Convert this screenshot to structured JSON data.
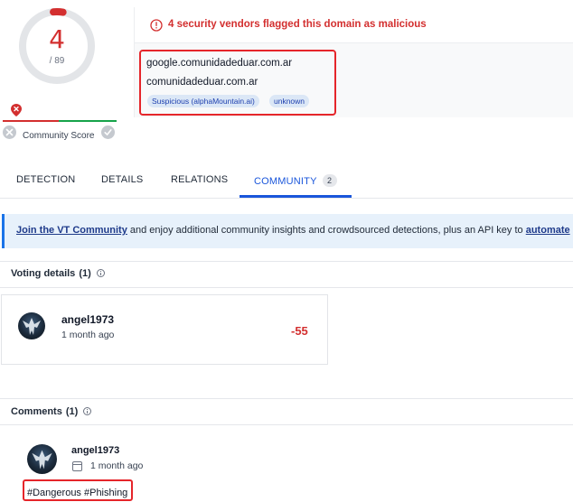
{
  "score": {
    "detections": "4",
    "total": "/ 89",
    "detection_fraction": 0.045,
    "community_score_label": "Community Score"
  },
  "alert": {
    "message": "4 security vendors flagged this domain as malicious",
    "domain": "google.comunidadeduar.com.ar",
    "parent_domain": "comunidadeduar.com.ar",
    "tags": [
      "Suspicious (alphaMountain.ai)",
      "unknown"
    ]
  },
  "tabs": {
    "detection": "DETECTION",
    "details": "DETAILS",
    "relations": "RELATIONS",
    "community": "COMMUNITY",
    "community_count": "2",
    "active": "community"
  },
  "join_banner": {
    "link": "Join the VT Community",
    "text": " and enjoy additional community insights and crowdsourced detections, plus an API key to ",
    "link2": "automate"
  },
  "voting": {
    "title": "Voting details",
    "count": "(1)",
    "user": "angel1973",
    "time": "1 month ago",
    "value": "-55"
  },
  "comments": {
    "title": "Comments",
    "count": "(1)",
    "user": "angel1973",
    "time": "1 month ago",
    "text": "#Dangerous #Phishing"
  },
  "colors": {
    "malicious": "#d32f2f",
    "accent": "#1a56db",
    "harmless": "#16a34a",
    "highlight_box": "#e5252a"
  }
}
